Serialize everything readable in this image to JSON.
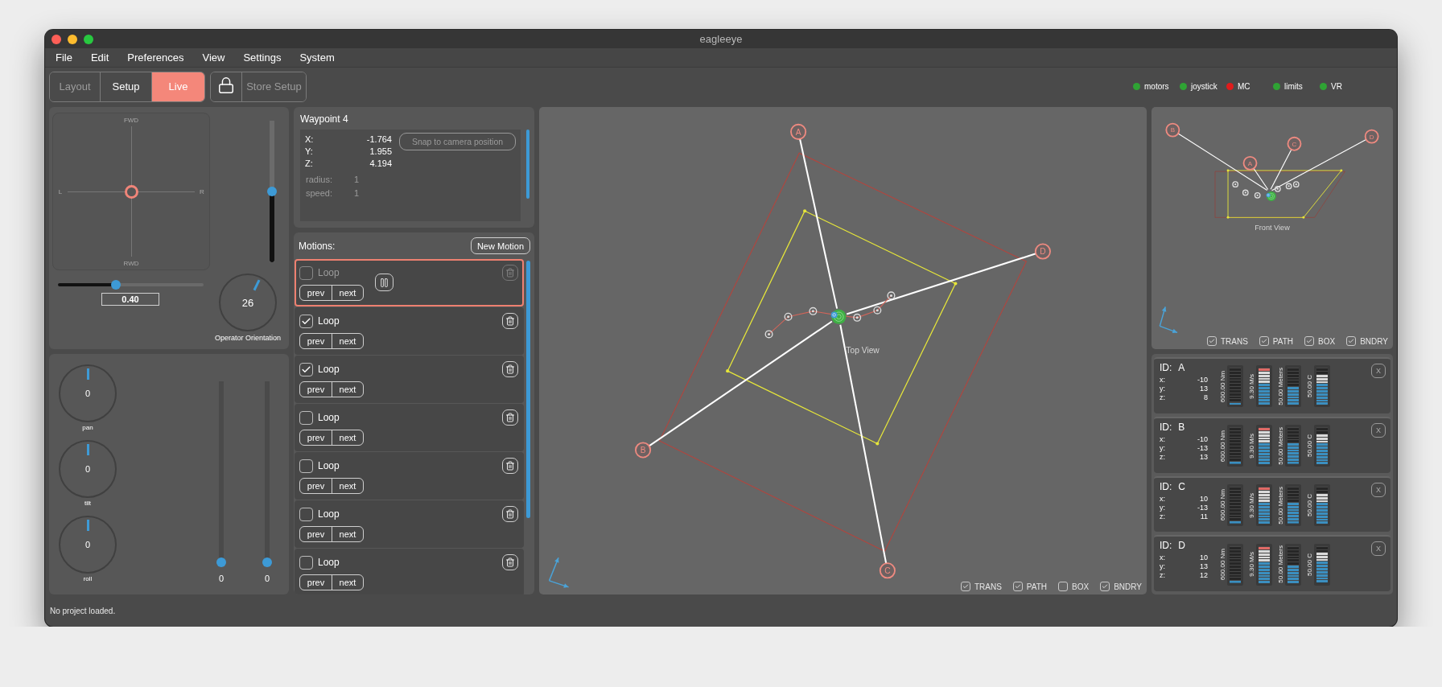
{
  "window": {
    "title": "eagleeye"
  },
  "menu": [
    "File",
    "Edit",
    "Preferences",
    "View",
    "Settings",
    "System"
  ],
  "modes": [
    {
      "label": "Layout",
      "selected": false,
      "disabled": true
    },
    {
      "label": "Setup",
      "selected": false,
      "disabled": false
    },
    {
      "label": "Live",
      "selected": true,
      "disabled": false
    }
  ],
  "store_setup": {
    "label": "Store Setup",
    "disabled": true
  },
  "indicators": [
    {
      "label": "motors",
      "color": "#2fa334"
    },
    {
      "label": "joystick",
      "color": "#2fa334"
    },
    {
      "label": "MC",
      "color": "#e01b1b"
    },
    {
      "label": "limits",
      "color": "#2fa334"
    },
    {
      "label": "VR",
      "color": "#2fa334"
    }
  ],
  "joystick": {
    "up": "FWD",
    "down": "RWD",
    "left": "L",
    "right": "R"
  },
  "lift_slider": {
    "level": 0.5
  },
  "speed_slider": {
    "level": 0.4,
    "value": "0.40"
  },
  "orientation_knob": {
    "value": "26",
    "label": "Operator Orientation"
  },
  "axis_knobs": [
    {
      "value": "0",
      "label": "pan"
    },
    {
      "value": "0",
      "label": "tilt"
    },
    {
      "value": "0",
      "label": "roll"
    }
  ],
  "axis_sliders": [
    {
      "value": "0",
      "level": 0
    },
    {
      "value": "0",
      "level": 0
    }
  ],
  "waypoint": {
    "title": "Waypoint 4",
    "coords": [
      {
        "label": "X:",
        "value": "-1.764"
      },
      {
        "label": "Y:",
        "value": "1.955"
      },
      {
        "label": "Z:",
        "value": "4.194"
      }
    ],
    "params": [
      {
        "label": "radius:",
        "value": "1"
      },
      {
        "label": "speed:",
        "value": "1"
      }
    ],
    "snap_button": {
      "label": "Snap to camera position",
      "disabled": true
    }
  },
  "motions": {
    "title": "Motions:",
    "new_button": "New Motion",
    "items": [
      {
        "label": "Loop",
        "checked": false,
        "selected": true,
        "prev": "prev",
        "next": "next"
      },
      {
        "label": "Loop",
        "checked": true,
        "selected": false,
        "prev": "prev",
        "next": "next"
      },
      {
        "label": "Loop",
        "checked": true,
        "selected": false,
        "prev": "prev",
        "next": "next"
      },
      {
        "label": "Loop",
        "checked": false,
        "selected": false,
        "prev": "prev",
        "next": "next"
      },
      {
        "label": "Loop",
        "checked": false,
        "selected": false,
        "prev": "prev",
        "next": "next"
      },
      {
        "label": "Loop",
        "checked": false,
        "selected": false,
        "prev": "prev",
        "next": "next"
      },
      {
        "label": "Loop",
        "checked": false,
        "selected": false,
        "prev": "prev",
        "next": "next"
      }
    ]
  },
  "top_view": {
    "label": "Top View",
    "nodes": [
      "A",
      "B",
      "C",
      "D"
    ],
    "toggles": [
      {
        "label": "TRANS",
        "checked": true
      },
      {
        "label": "PATH",
        "checked": true
      },
      {
        "label": "BOX",
        "checked": false
      },
      {
        "label": "BNDRY",
        "checked": true
      }
    ]
  },
  "front_view": {
    "label": "Front View",
    "nodes": [
      "B",
      "C",
      "D",
      "A"
    ],
    "toggles": [
      {
        "label": "TRANS",
        "checked": true
      },
      {
        "label": "PATH",
        "checked": true
      },
      {
        "label": "BOX",
        "checked": true
      },
      {
        "label": "BNDRY",
        "checked": true
      }
    ]
  },
  "trackers": [
    {
      "id_label": "ID:",
      "id": "A",
      "close": "X",
      "coords": [
        {
          "label": "x:",
          "value": "-10"
        },
        {
          "label": "y:",
          "value": "13"
        },
        {
          "label": "z:",
          "value": "8"
        }
      ],
      "meters": [
        {
          "label": "600.00 Nm",
          "level": 0.08
        },
        {
          "label": "9.30 M/s",
          "level": 1
        },
        {
          "label": "50.00 Meters",
          "level": 0.5
        },
        {
          "label": "50.00 C",
          "level": 0.83
        }
      ]
    },
    {
      "id_label": "ID:",
      "id": "B",
      "close": "X",
      "coords": [
        {
          "label": "x:",
          "value": "-10"
        },
        {
          "label": "y:",
          "value": "-13"
        },
        {
          "label": "z:",
          "value": "13"
        }
      ],
      "meters": [
        {
          "label": "600.00 Nm",
          "level": 0.08
        },
        {
          "label": "9.30 M/s",
          "level": 1
        },
        {
          "label": "50.00 Meters",
          "level": 0.58
        },
        {
          "label": "50.00 C",
          "level": 0.83
        }
      ]
    },
    {
      "id_label": "ID:",
      "id": "C",
      "close": "X",
      "coords": [
        {
          "label": "x:",
          "value": "10"
        },
        {
          "label": "y:",
          "value": "-13"
        },
        {
          "label": "z:",
          "value": "11"
        }
      ],
      "meters": [
        {
          "label": "600.00 Nm",
          "level": 0.08
        },
        {
          "label": "9.30 M/s",
          "level": 1
        },
        {
          "label": "50.00 Meters",
          "level": 0.58
        },
        {
          "label": "50.00 C",
          "level": 0.83
        }
      ]
    },
    {
      "id_label": "ID:",
      "id": "D",
      "close": "X",
      "coords": [
        {
          "label": "x:",
          "value": "10"
        },
        {
          "label": "y:",
          "value": "13"
        },
        {
          "label": "z:",
          "value": "12"
        }
      ],
      "meters": [
        {
          "label": "600.00 Nm",
          "level": 0.08
        },
        {
          "label": "9.30 M/s",
          "level": 1
        },
        {
          "label": "50.00 Meters",
          "level": 0.5
        },
        {
          "label": "50.00 C",
          "level": 0.83
        }
      ]
    }
  ],
  "status_bar": "No project loaded."
}
